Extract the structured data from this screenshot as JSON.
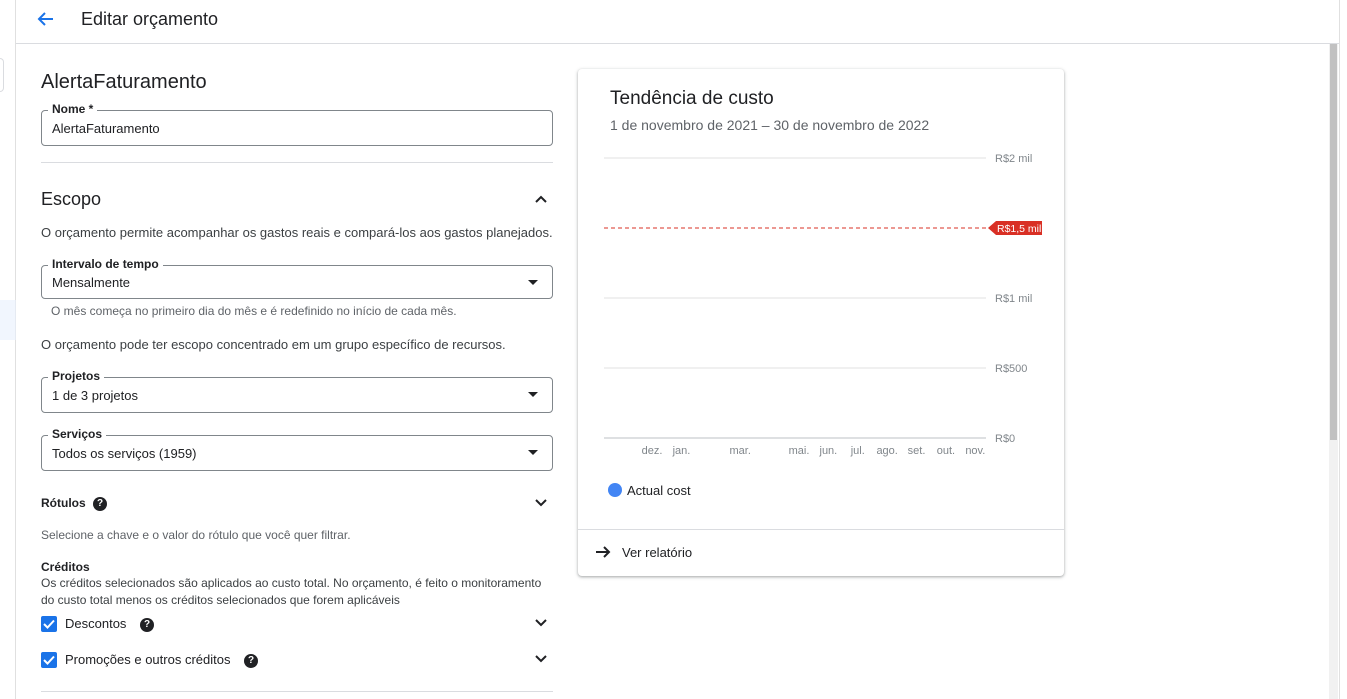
{
  "header": {
    "title": "Editar orçamento"
  },
  "budget_name_heading": "AlertaFaturamento",
  "name_field": {
    "label": "Nome *",
    "value": "AlertaFaturamento"
  },
  "scope": {
    "heading": "Escopo",
    "description": "O orçamento permite acompanhar os gastos reais e compará-los aos gastos planejados.",
    "interval": {
      "label": "Intervalo de tempo",
      "value": "Mensalmente",
      "hint": "O mês começa no primeiro dia do mês e é redefinido no início de cada mês."
    },
    "resource_desc": "O orçamento pode ter escopo concentrado em um grupo específico de recursos.",
    "projects": {
      "label": "Projetos",
      "value": "1 de 3 projetos"
    },
    "services": {
      "label": "Serviços",
      "value": "Todos os serviços (1959)"
    },
    "labels": {
      "title": "Rótulos",
      "desc": "Selecione a chave e o valor do rótulo que você quer filtrar."
    },
    "credits": {
      "title": "Créditos",
      "desc_1": "Os créditos selecionados são aplicados ao custo total. No orçamento, é feito o monitoramento",
      "desc_2": "do custo total menos os créditos selecionados que forem aplicáveis",
      "discounts": "Descontos",
      "promotions": "Promoções e outros créditos"
    }
  },
  "card": {
    "title": "Tendência de custo",
    "subtitle": "1 de novembro de 2021 – 30 de novembro de 2022",
    "legend": "Actual cost",
    "view_report": "Ver relatório"
  },
  "colors": {
    "accent": "#1a73e8",
    "budget_line": "#d93025",
    "series": "#4285f4"
  },
  "chart_data": {
    "type": "line",
    "title": "Tendência de custo",
    "categories": [
      "dez.",
      "jan.",
      "mar.",
      "mai.",
      "jun.",
      "jul.",
      "ago.",
      "set.",
      "out.",
      "nov."
    ],
    "y_ticks": [
      "R$0",
      "R$500",
      "R$1 mil",
      "R$2 mil"
    ],
    "y_tick_values": [
      0,
      500,
      1000,
      2000
    ],
    "ylim": [
      0,
      2000
    ],
    "budget_line": {
      "value": 1500,
      "label": "R$1,5 mil"
    },
    "series": [
      {
        "name": "Actual cost",
        "values": [
          0,
          0,
          0,
          0,
          0,
          0,
          0,
          0,
          0,
          0
        ]
      }
    ],
    "grid": true,
    "legend_position": "bottom-left"
  }
}
